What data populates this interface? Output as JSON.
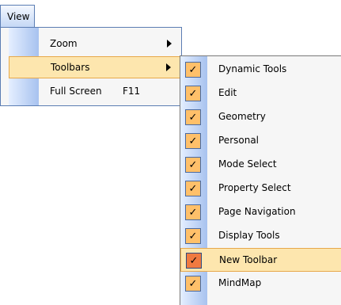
{
  "menubar": {
    "view_label": "View"
  },
  "view_menu": {
    "items": [
      {
        "label": "Zoom",
        "shortcut": "",
        "has_submenu": true
      },
      {
        "label": "Toolbars",
        "shortcut": "",
        "has_submenu": true
      },
      {
        "label": "Full Screen",
        "shortcut": "F11",
        "has_submenu": false
      }
    ],
    "highlighted_item": "Toolbars"
  },
  "toolbars_submenu": {
    "check_glyph": "✓",
    "items": [
      {
        "label": "Dynamic Tools",
        "checked": true
      },
      {
        "label": "Edit",
        "checked": true
      },
      {
        "label": "Geometry",
        "checked": true
      },
      {
        "label": "Personal",
        "checked": true
      },
      {
        "label": "Mode Select",
        "checked": true
      },
      {
        "label": "Property Select",
        "checked": true
      },
      {
        "label": "Page Navigation",
        "checked": true
      },
      {
        "label": "Display Tools",
        "checked": true
      },
      {
        "label": "New Toolbar",
        "checked": true
      },
      {
        "label": "MindMap",
        "checked": true
      }
    ],
    "highlighted_item": "New Toolbar"
  },
  "colors": {
    "highlight_bg": "#fde6ae",
    "highlight_border": "#e7a84b",
    "check_bg": "#ffc06a",
    "check_hover_bg": "#f07a40",
    "gutter_light": "#e5efff",
    "gutter_dark": "#a7c2ef"
  }
}
